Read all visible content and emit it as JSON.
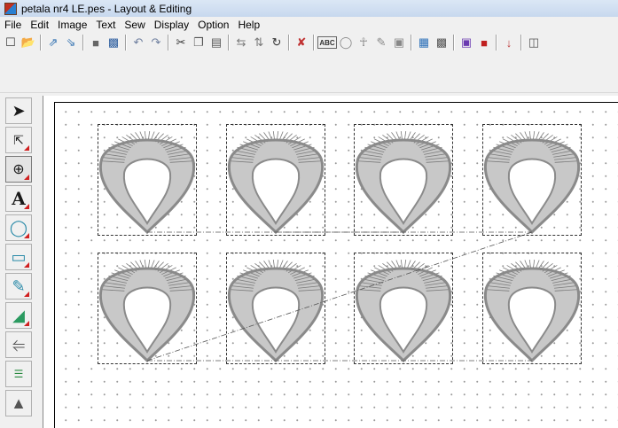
{
  "window": {
    "title": "petala nr4 LE.pes - Layout & Editing"
  },
  "menu": [
    "File",
    "Edit",
    "Image",
    "Text",
    "Sew",
    "Display",
    "Option",
    "Help"
  ],
  "toolbar": {
    "icons": [
      "new-file-icon",
      "open-folder-icon",
      "import-icon",
      "export-icon",
      "save-icon",
      "send-to-card-icon",
      "undo-icon",
      "redo-icon",
      "cut-icon",
      "copy-icon",
      "paste-icon",
      "mirror-icon",
      "flip-icon",
      "rotate-icon",
      "properties-icon",
      "text-abc-icon",
      "arrange-text-icon",
      "font-icon",
      "wizard-icon",
      "image-icon",
      "design-page-icon",
      "view-icon",
      "stitch-simulator-icon",
      "realistic-preview-icon",
      "sew-order-icon",
      "window-icon"
    ]
  },
  "left_tools": [
    "select-arrow-icon",
    "point-edit-icon",
    "zoom-icon",
    "text-tool-icon",
    "circle-shape-icon",
    "rectangle-shape-icon",
    "outline-icon",
    "stamp-shape-icon",
    "measure-icon",
    "sewing-order-icon",
    "stamp-icon"
  ],
  "colors": {
    "stitch": "#8a8a8a",
    "frame_dash": "#333333",
    "connector": "#555555"
  }
}
